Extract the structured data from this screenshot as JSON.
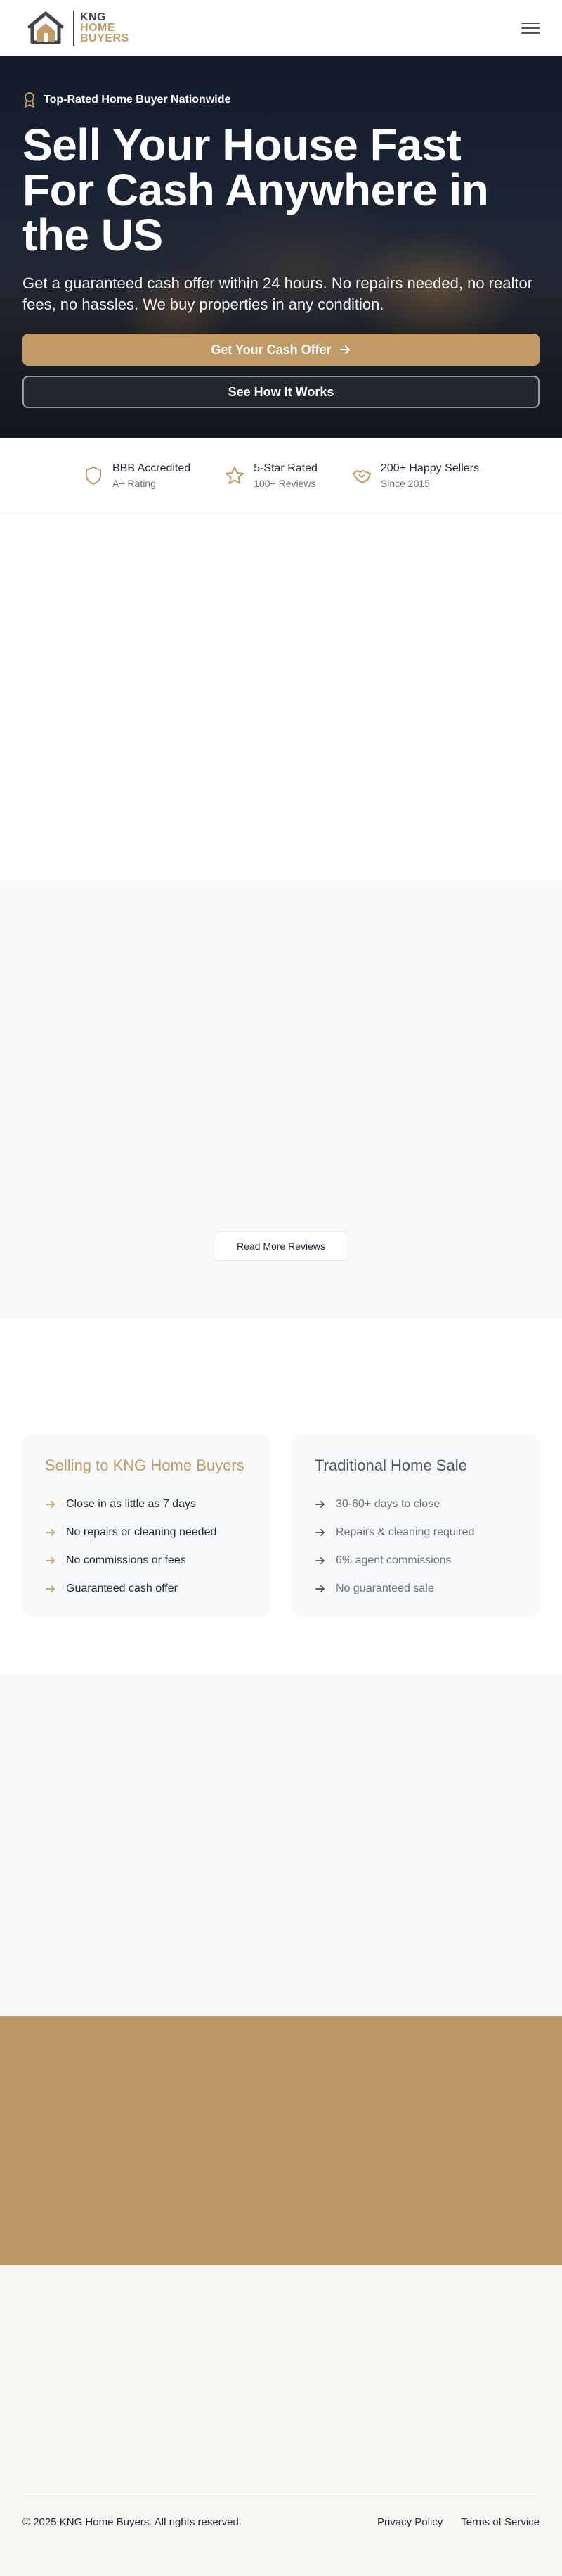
{
  "header": {
    "logo_line1": "KNG",
    "logo_line2": "HOME",
    "logo_line3": "BUYERS",
    "menu_icon": "hamburger-menu-icon"
  },
  "hero": {
    "badge": "Top-Rated Home Buyer Nationwide",
    "badge_icon": "award-ribbon-icon",
    "title": "Sell Your House Fast For Cash Anywhere in the US",
    "subtitle": "Get a guaranteed cash offer within 24 hours. No repairs needed, no realtor fees, no hassles. We buy properties in any condition.",
    "primary_cta": "Get Your Cash Offer",
    "secondary_cta": "See How It Works"
  },
  "trust": [
    {
      "icon": "shield-icon",
      "title": "BBB Accredited",
      "subtitle": "A+ Rating"
    },
    {
      "icon": "star-icon",
      "title": "5-Star Rated",
      "subtitle": "100+ Reviews"
    },
    {
      "icon": "handshake-icon",
      "title": "200+ Happy Sellers",
      "subtitle": "Since 2015"
    }
  ],
  "reviews": {
    "button": "Read More Reviews"
  },
  "comparison": {
    "kng": {
      "title": "Selling to KNG Home Buyers",
      "items": [
        "Close in as little as 7 days",
        "No repairs or cleaning needed",
        "No commissions or fees",
        "Guaranteed cash offer"
      ]
    },
    "traditional": {
      "title": "Traditional Home Sale",
      "items": [
        "30-60+ days to close",
        "Repairs & cleaning required",
        "6% agent commissions",
        "No guaranteed sale"
      ]
    }
  },
  "footer": {
    "copyright": "© 2025 KNG Home Buyers. All rights reserved.",
    "privacy": "Privacy Policy",
    "terms": "Terms of Service"
  },
  "colors": {
    "brand_gold": "#c19a65",
    "dark_gray": "#3f434a"
  }
}
